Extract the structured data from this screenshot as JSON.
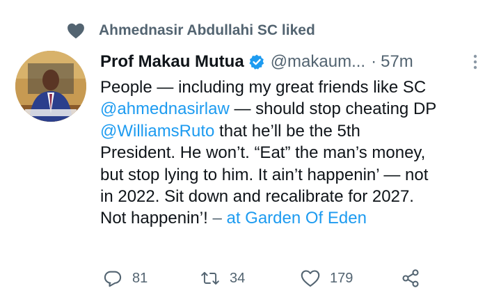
{
  "social_context": {
    "icon": "heart-filled-icon",
    "text": "Ahmednasir Abdullahi SC liked"
  },
  "tweet": {
    "author": {
      "name": "Prof Makau Mutua",
      "verified": true,
      "handle": "@makaum...",
      "avatar_icon": "user-avatar"
    },
    "separator": "·",
    "time": "57m",
    "body": {
      "line1": "People — including my great friends like SC",
      "line2_link": "@ahmednasirlaw",
      "line2_rest": " — should stop cheating DP",
      "line3_link": "@WilliamsRuto",
      "line3_rest": " that he’ll be the 5th",
      "line4": "President.  He won’t. “Eat” the man’s money,",
      "line5": "but stop lying to him.  It ain’t happenin’ — not",
      "line6": "in 2022.  Sit down and recalibrate for 2027.",
      "line7_text": "Not happenin’! ",
      "line7_dash": "–",
      "line7_location": " at Garden Of Eden"
    },
    "actions": {
      "reply_count": "81",
      "retweet_count": "34",
      "like_count": "179"
    }
  },
  "colors": {
    "text": "#0f1419",
    "secondary": "#536471",
    "link": "#1d9bf0",
    "verified": "#1d9bf0"
  }
}
